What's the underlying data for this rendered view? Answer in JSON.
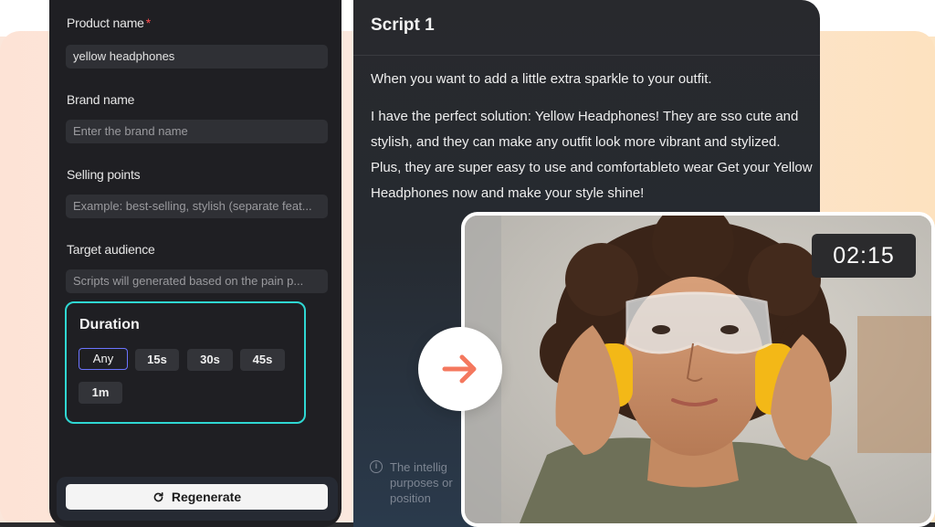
{
  "form": {
    "product_name_label": "Product name",
    "product_name_required": "*",
    "product_name_value": "yellow headphones",
    "brand_name_label": "Brand name",
    "brand_name_placeholder": "Enter the brand name",
    "selling_points_label": "Selling points",
    "selling_points_placeholder": "Example: best-selling, stylish (separate feat...",
    "target_audience_label": "Target audience",
    "target_audience_placeholder": "Scripts will generated based on the pain p...",
    "duration": {
      "title": "Duration",
      "options": [
        "Any",
        "15s",
        "30s",
        "45s",
        "1m"
      ],
      "selected": "Any"
    },
    "regenerate_label": "Regenerate"
  },
  "script": {
    "title": "Script 1",
    "paragraphs": [
      "When you want to add a little extra sparkle to your outfit.",
      "I have the perfect solution: Yellow Headphones! They are sso cute and stylish, and they can make any outfit look more vibrant and stylized. Plus, they are super easy to use and comfortableto wear Get your Yellow Headphones now and make your style shine!"
    ],
    "info_note": "The intellig purposes or position"
  },
  "video": {
    "timer": "02:15"
  },
  "colors": {
    "accent_cyan": "#2fd7d2",
    "selected_purple": "#6c74ff",
    "arrow_coral": "#f4785e",
    "headphone_yellow": "#f3b817"
  },
  "icons": {
    "regenerate": "refresh-icon",
    "next": "arrow-right-icon",
    "info": "info-icon"
  }
}
